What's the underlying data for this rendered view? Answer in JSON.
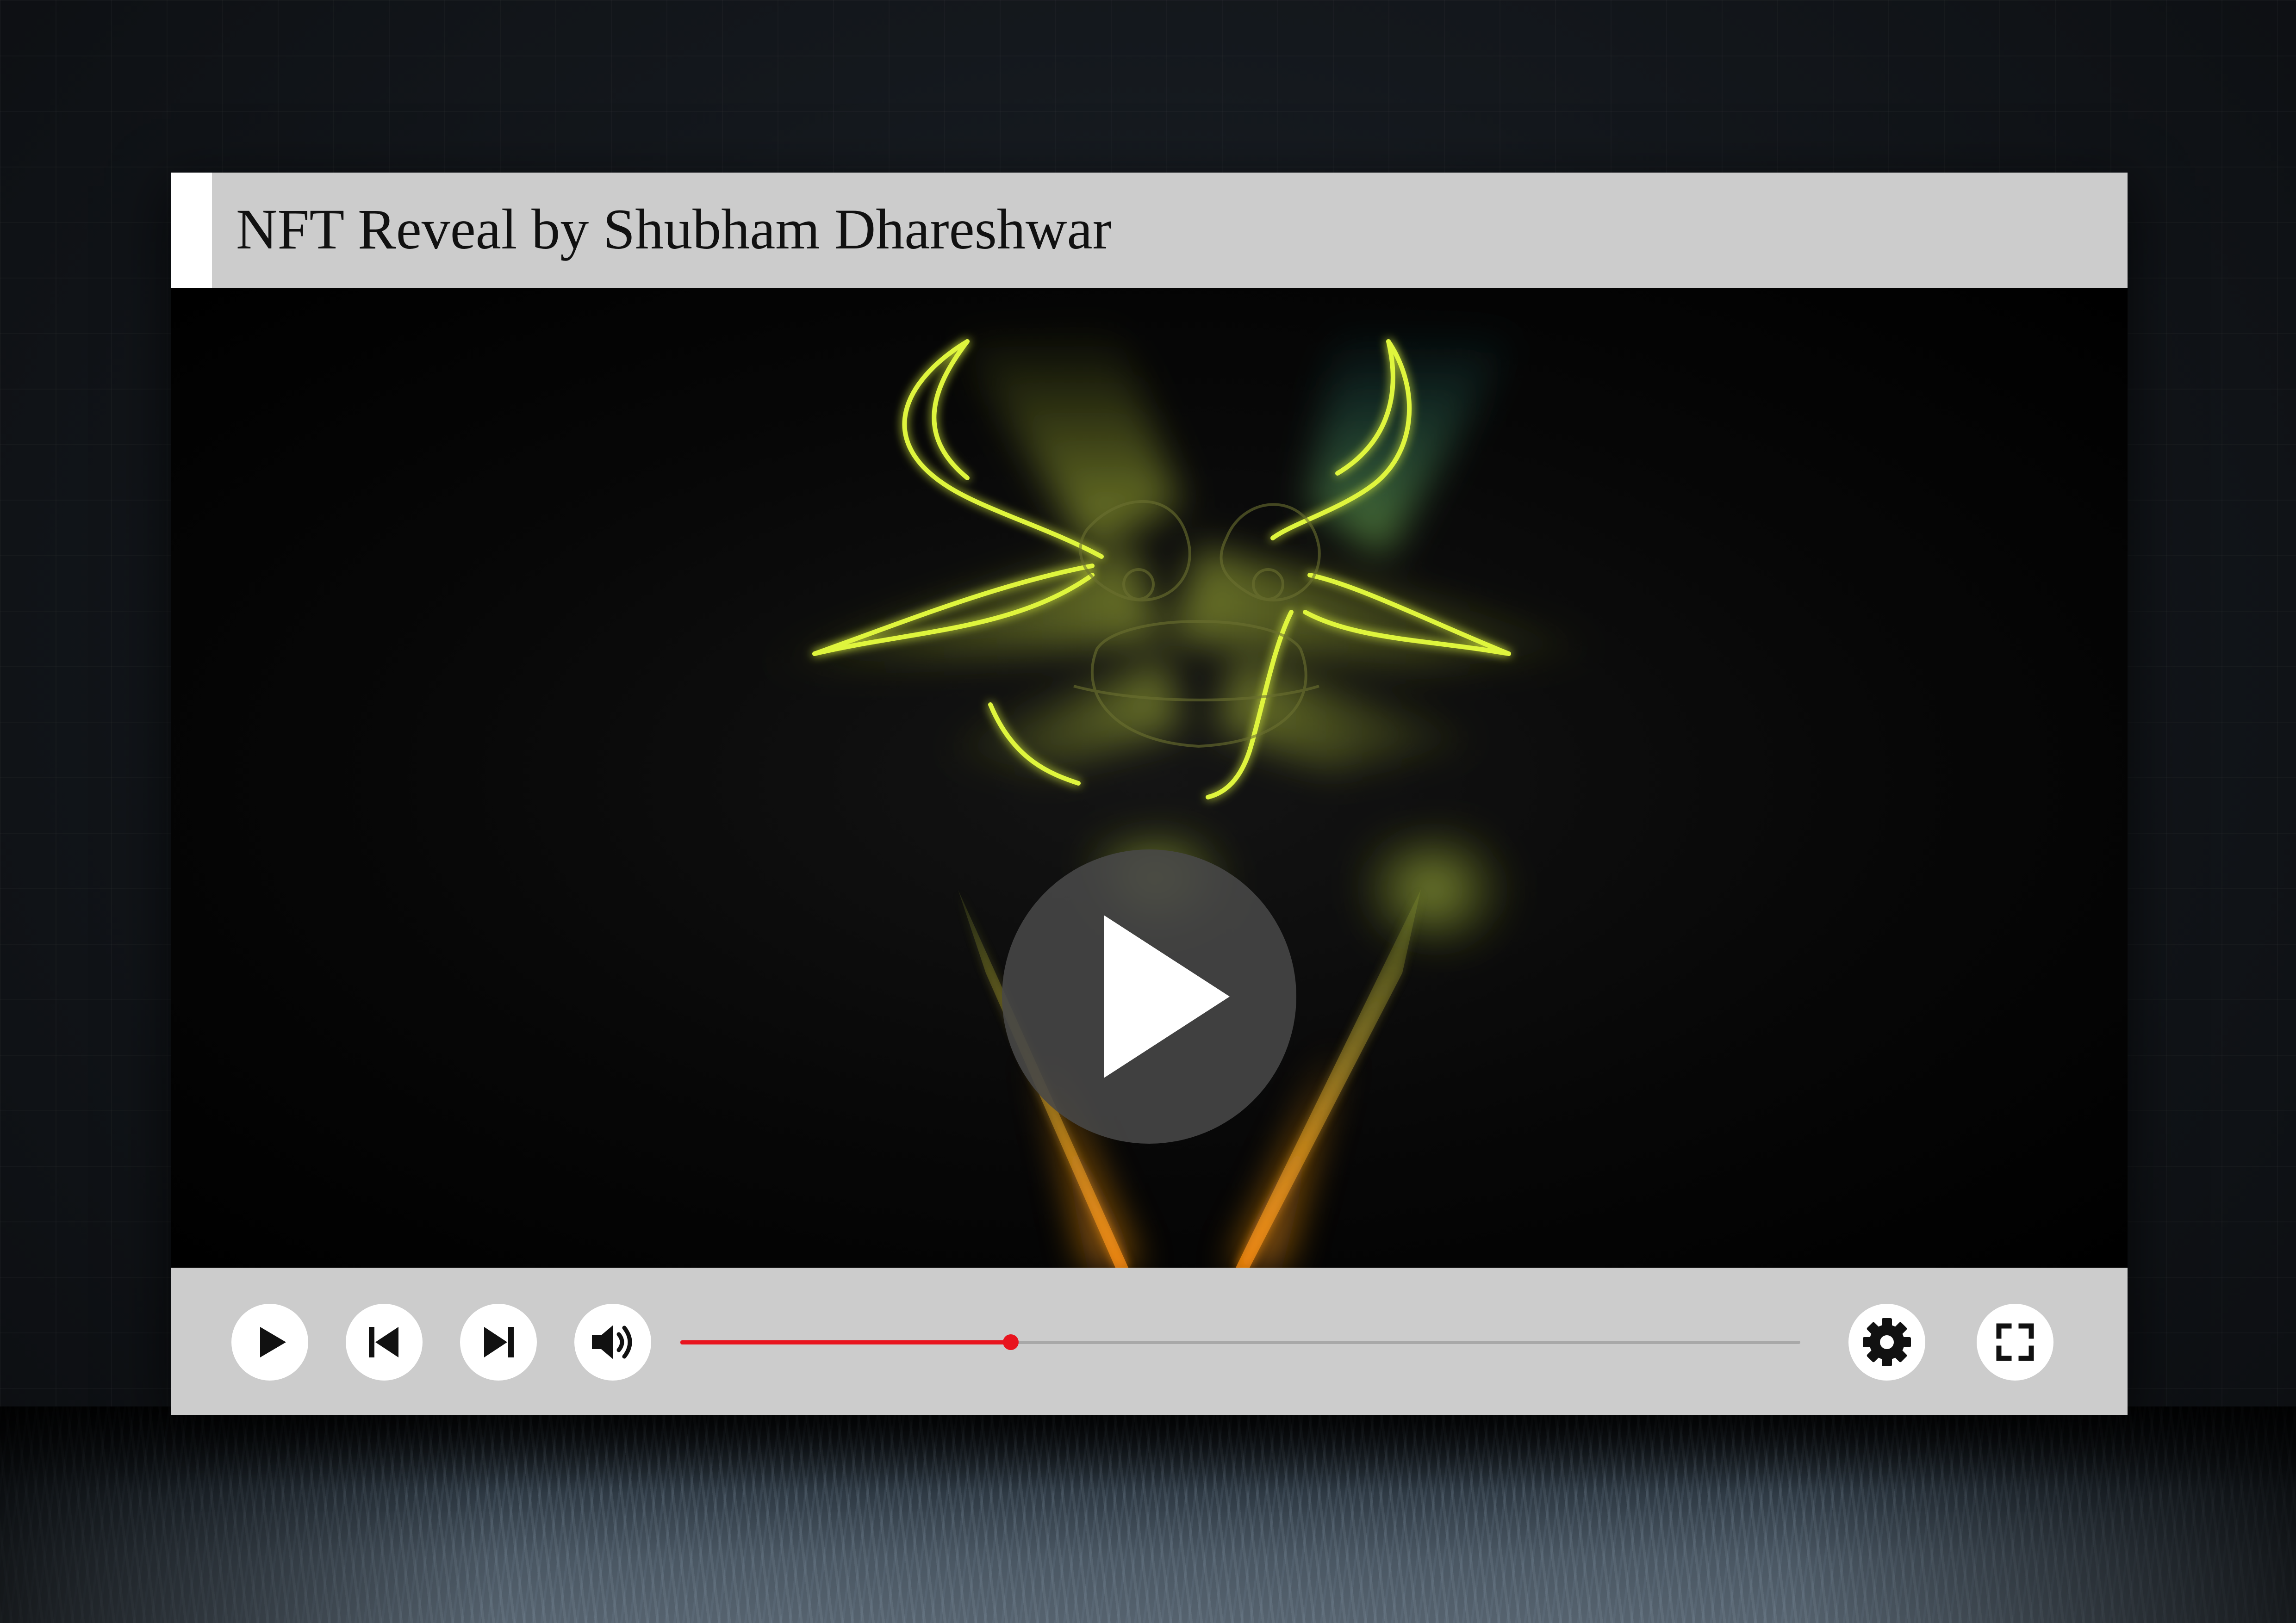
{
  "player": {
    "title": "NFT Reveal by Shubham Dhareshwar",
    "video": {
      "poster_subject": "neon-bull-head-icon",
      "overlay_play": "play-icon"
    },
    "controls": {
      "play": "play-icon",
      "previous": "skip-previous-icon",
      "next": "skip-next-icon",
      "volume": "volume-icon",
      "settings": "gear-icon",
      "fullscreen": "fullscreen-icon"
    },
    "progress": 0.295
  },
  "colors": {
    "progress_played": "#e8141e",
    "progress_track": "#a8a8a8",
    "bar_background": "#cccccc",
    "neon_yellow": "#d8f23a",
    "neon_orange": "#ff9a1a"
  }
}
